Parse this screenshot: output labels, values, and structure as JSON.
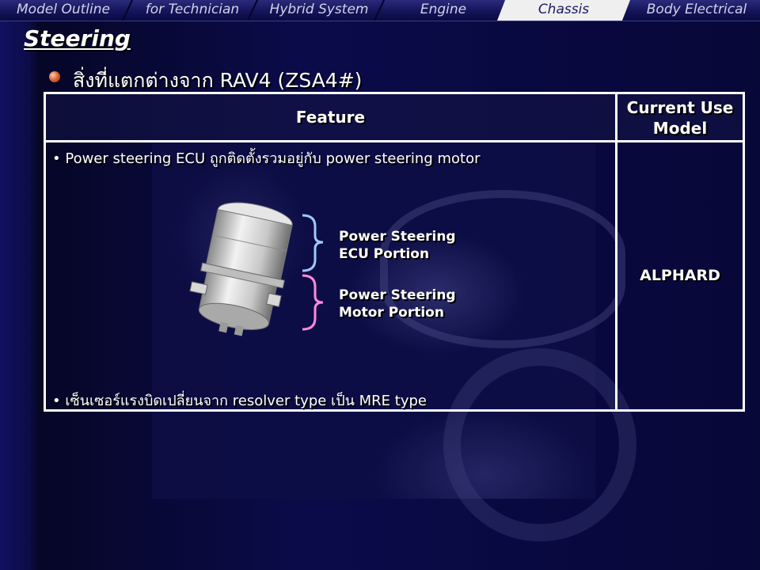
{
  "nav": {
    "items": [
      {
        "label": "Model Outline"
      },
      {
        "label": "for Technician"
      },
      {
        "label": "Hybrid System"
      },
      {
        "label": "Engine"
      },
      {
        "label": "Chassis"
      },
      {
        "label": "Body Electrical"
      }
    ],
    "active_label": "Chassis"
  },
  "page": {
    "title": "Steering",
    "subtitle": "สิ่งที่แตกต่างจาก RAV4 (ZSA4#)"
  },
  "table": {
    "headers": {
      "feature": "Feature",
      "model_line1": "Current Use",
      "model_line2": "Model"
    },
    "rows": [
      {
        "bullets": [
          "Power steering ECU ถูกติดตั้งรวมอยู่กับ power steering motor",
          "เซ็นเซอร์แรงบิดเปลี่ยนจาก resolver type เป็น MRE type"
        ],
        "model": "ALPHARD"
      }
    ]
  },
  "figure": {
    "callout_ecu_line1": "Power Steering",
    "callout_ecu_line2": "ECU Portion",
    "callout_motor_line1": "Power Steering",
    "callout_motor_line2": "Motor Portion",
    "bracket_ecu_color": "#9fc8ff",
    "bracket_motor_color": "#ff8ad8"
  },
  "colors": {
    "background": "#0a0a3a",
    "text": "#ffffff",
    "nav_active_bg": "#efefef"
  }
}
